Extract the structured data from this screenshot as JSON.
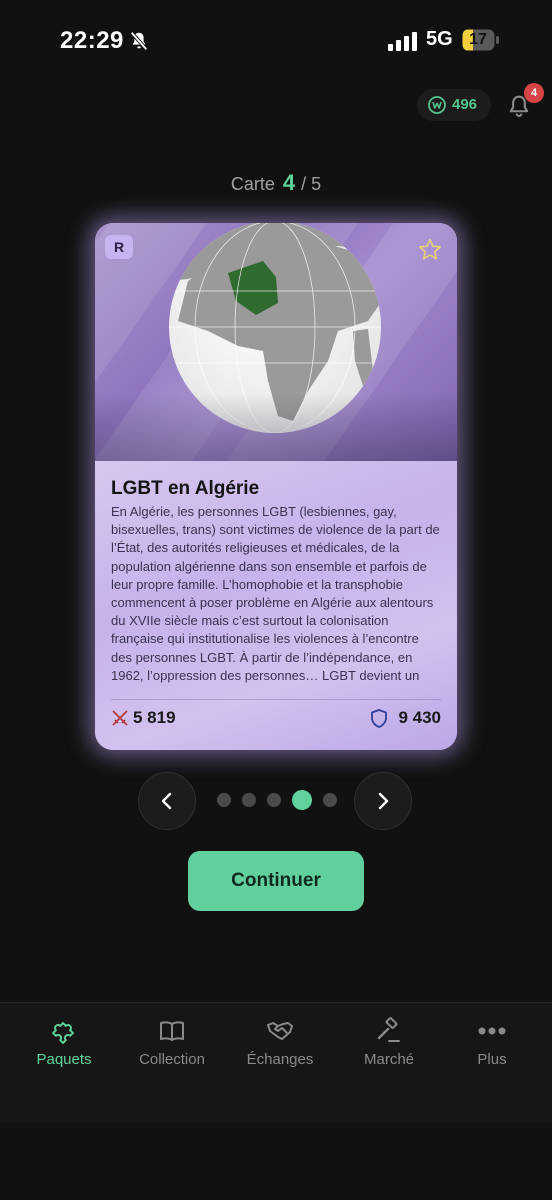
{
  "status": {
    "time": "22:29",
    "network": "5G",
    "battery": "17"
  },
  "header": {
    "coins": "496",
    "notifications": "4"
  },
  "counter": {
    "label": "Carte",
    "current": "4",
    "total": "/ 5"
  },
  "card": {
    "rarity": "R",
    "title": "LGBT en Algérie",
    "text": "En Algérie, les personnes LGBT (lesbiennes, gay, bisexuelles, trans) sont victimes de violence de la part de l’État, des autorités religieuses et médicales, de la population algérienne dans son ensemble et parfois de leur propre famille. L’homophobie et la transphobie commencent à poser problème en Algérie aux alentours du XVIIe siècle mais c’est surtout la colonisation française qui institutionalise les violences à l’encontre des personnes LGBT. À partir de l’indépendance, en 1962, l’oppression des personnes… LGBT devient un outil permettant l’émergence d’une",
    "attack": "5 819",
    "defense": "9 430"
  },
  "pager": {
    "total": 5,
    "active": 4
  },
  "continue_label": "Continuer",
  "tabs": [
    {
      "label": "Paquets",
      "icon": "puzzle-icon",
      "active": true
    },
    {
      "label": "Collection",
      "icon": "book-icon",
      "active": false
    },
    {
      "label": "Échanges",
      "icon": "handshake-icon",
      "active": false
    },
    {
      "label": "Marché",
      "icon": "gavel-icon",
      "active": false
    },
    {
      "label": "Plus",
      "icon": "more-icon",
      "active": false
    }
  ],
  "colors": {
    "accent": "#5fd39b",
    "background": "#111111",
    "card": "#cdbbe8",
    "badge": "#d64545"
  }
}
